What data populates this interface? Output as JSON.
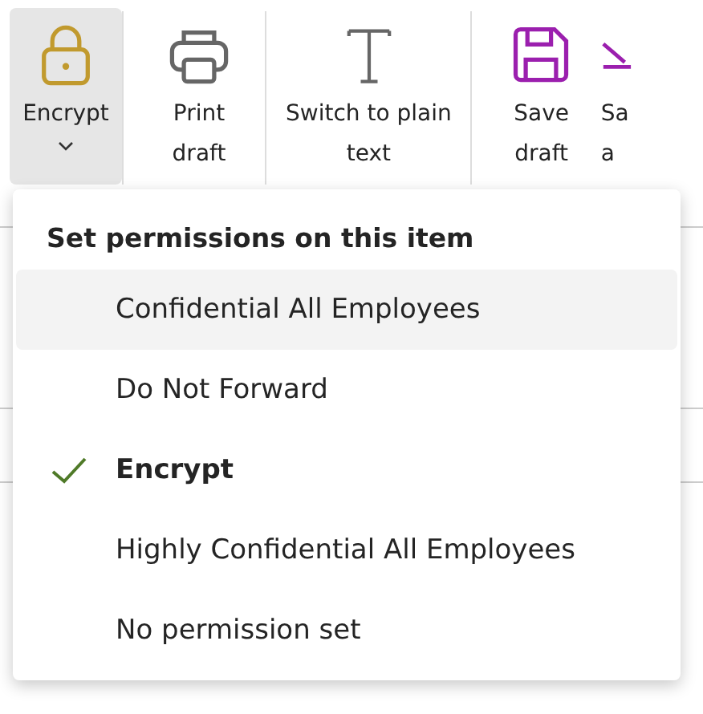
{
  "toolbar": [
    {
      "kind": "lock",
      "lines": [
        "Encrypt"
      ],
      "dropdown": true,
      "selected": true
    },
    {
      "kind": "printer",
      "lines": [
        "Print",
        "draft"
      ],
      "dropdown": false,
      "selected": false
    },
    {
      "kind": "text",
      "lines": [
        "Switch to plain",
        "text"
      ],
      "dropdown": false,
      "selected": false
    },
    {
      "kind": "save",
      "lines": [
        "Save",
        "draft"
      ],
      "dropdown": false,
      "selected": false
    },
    {
      "kind": "save-as",
      "lines": [
        "Sa",
        "a"
      ],
      "dropdown": false,
      "selected": false
    }
  ],
  "menu": {
    "heading": "Set permissions on this item",
    "items": [
      {
        "label": "Confidential All Employees",
        "checked": false,
        "hovered": true
      },
      {
        "label": "Do Not Forward",
        "checked": false,
        "hovered": false
      },
      {
        "label": "Encrypt",
        "checked": true,
        "hovered": false
      },
      {
        "label": "Highly Confidential All Employees",
        "checked": false,
        "hovered": false
      },
      {
        "label": "No permission set",
        "checked": false,
        "hovered": false
      }
    ]
  }
}
